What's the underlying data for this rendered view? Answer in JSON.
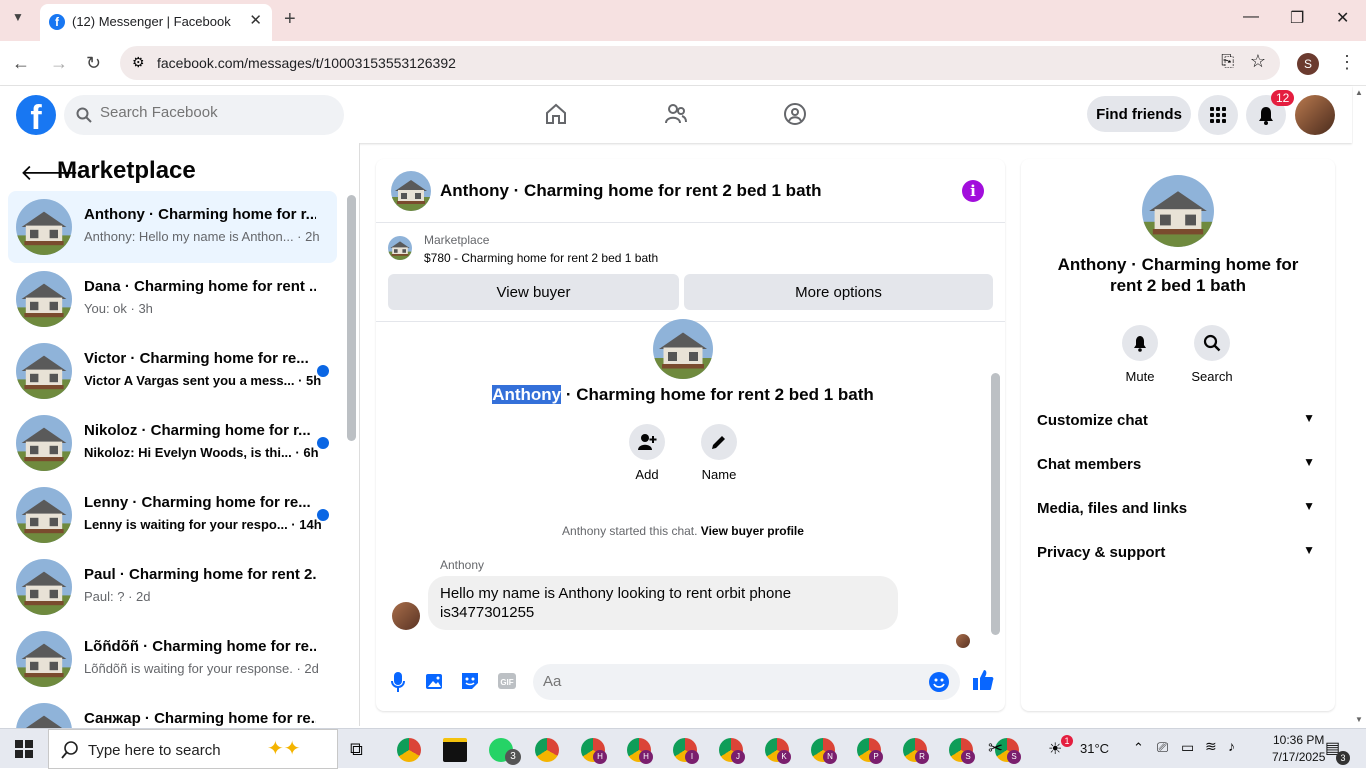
{
  "browser": {
    "tab_title": "(12) Messenger | Facebook",
    "url": "facebook.com/messages/t/10003153553126392",
    "profile_initial": "S"
  },
  "fb_header": {
    "search_placeholder": "Search Facebook",
    "find_friends_label": "Find friends",
    "notification_count": "12"
  },
  "left_panel": {
    "title": "Marketplace",
    "conversations": [
      {
        "name": "Anthony · Charming home for r...",
        "preview": "Anthony: Hello my name is Anthon... · 2h",
        "unread": false,
        "selected": true
      },
      {
        "name": "Dana · Charming home for rent ...",
        "preview": "You: ok · 3h",
        "unread": false,
        "selected": false
      },
      {
        "name": "Victor · Charming home for re...",
        "preview": "Victor A Vargas sent you a mess... · 5h",
        "unread": true,
        "selected": false
      },
      {
        "name": "Nikoloz · Charming home for r...",
        "preview": "Nikoloz: Hi Evelyn Woods, is thi... · 6h",
        "unread": true,
        "selected": false
      },
      {
        "name": "Lenny · Charming home for re...",
        "preview": "Lenny is waiting for your respo... · 14h",
        "unread": true,
        "selected": false
      },
      {
        "name": "Paul · Charming home for rent 2...",
        "preview": "Paul: ? · 2d",
        "unread": false,
        "selected": false
      },
      {
        "name": "Lõñdõñ · Charming home for re...",
        "preview": "Lõñdõñ is waiting for your response. · 2d",
        "unread": false,
        "selected": false
      },
      {
        "name": "Санжар · Charming home for re...",
        "preview": "",
        "unread": false,
        "selected": false
      }
    ]
  },
  "chat": {
    "header_title": "Anthony · Charming home for rent 2 bed 1 bath",
    "marketplace_label": "Marketplace",
    "listing": "$780 - Charming home for rent 2 bed 1 bath",
    "view_buyer_label": "View buyer",
    "more_options_label": "More options",
    "intro_name": "Anthony",
    "intro_rest": " · Charming home for rent 2 bed 1 bath",
    "add_label": "Add",
    "name_label": "Name",
    "started_text": "Anthony started this chat. ",
    "view_profile_label": "View buyer profile",
    "sender": "Anthony",
    "message": "Hello my name is Anthony looking to rent orbit phone is3477301255",
    "input_placeholder": "Aa"
  },
  "details": {
    "title": "Anthony · Charming home for rent 2 bed 1 bath",
    "mute_label": "Mute",
    "search_label": "Search",
    "sections": [
      "Customize chat",
      "Chat members",
      "Media, files and links",
      "Privacy & support"
    ]
  },
  "taskbar": {
    "search_placeholder": "Type here to search",
    "weather": "31°C",
    "weather_badge": "1",
    "time": "10:36 PM",
    "date": "7/17/2025",
    "notif_count": "3",
    "whatsapp_count": "3",
    "chrome_profiles": [
      "",
      "H",
      "H",
      "I",
      "J",
      "K",
      "N",
      "P",
      "R",
      "S",
      "S"
    ]
  },
  "colors": {
    "fb_blue": "#1877f2",
    "unread_dot": "#0a66e4",
    "info_purple": "#a20edc"
  }
}
